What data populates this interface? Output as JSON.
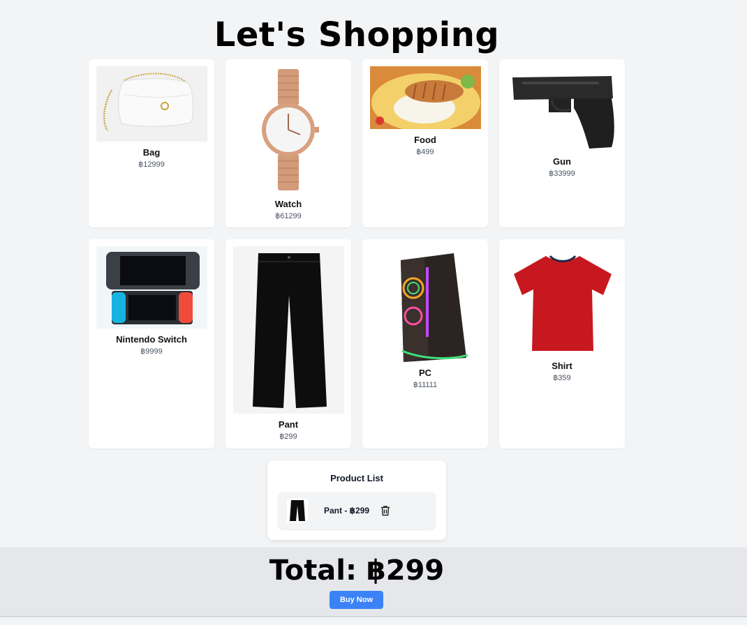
{
  "page": {
    "title": "Let's Shopping"
  },
  "products": [
    {
      "name": "Bag",
      "price": "฿12999",
      "image": "white-chain-shoulder-bag"
    },
    {
      "name": "Watch",
      "price": "฿61299",
      "image": "rose-gold-wristwatch"
    },
    {
      "name": "Food",
      "price": "฿499",
      "image": "chicken-rice-plate"
    },
    {
      "name": "Gun",
      "price": "฿33999",
      "image": "black-pistol"
    },
    {
      "name": "Nintendo Switch",
      "price": "฿9999",
      "image": "nintendo-switch-console"
    },
    {
      "name": "Pant",
      "price": "฿299",
      "image": "black-pants"
    },
    {
      "name": "PC",
      "price": "฿11111",
      "image": "gaming-pc-tower"
    },
    {
      "name": "Shirt",
      "price": "฿359",
      "image": "red-t-shirt"
    }
  ],
  "cart": {
    "title": "Product List",
    "items": [
      {
        "label": "Pant - ฿299",
        "image": "black-pants",
        "remove_icon": "trash-icon"
      }
    ]
  },
  "footer": {
    "total": "Total: ฿299",
    "buy_label": "Buy Now"
  },
  "colors": {
    "page_bg": "#f3f4f6",
    "footer_bg": "#e5e7eb",
    "accent": "#3b82f6"
  }
}
